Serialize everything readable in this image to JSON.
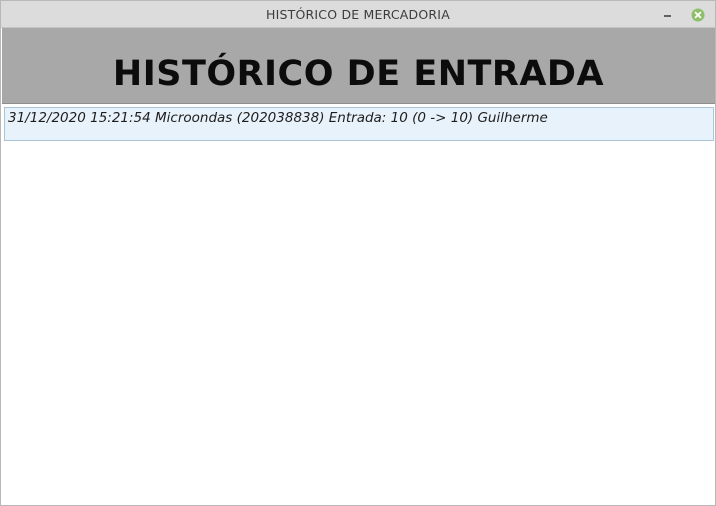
{
  "window": {
    "title": "HISTÓRICO DE MERCADORIA",
    "buttons": {
      "minimize_icon": "minimize-icon",
      "close_icon": "close-icon",
      "close_color": "#8fbf6a"
    }
  },
  "header": {
    "title": "HISTÓRICO DE ENTRADA",
    "background": "#a8a8a8"
  },
  "history": {
    "items": [
      {
        "text": "31/12/2020 15:21:54 Microondas (202038838) Entrada: 10 (0 -> 10) Guilherme",
        "selected": true
      }
    ]
  }
}
